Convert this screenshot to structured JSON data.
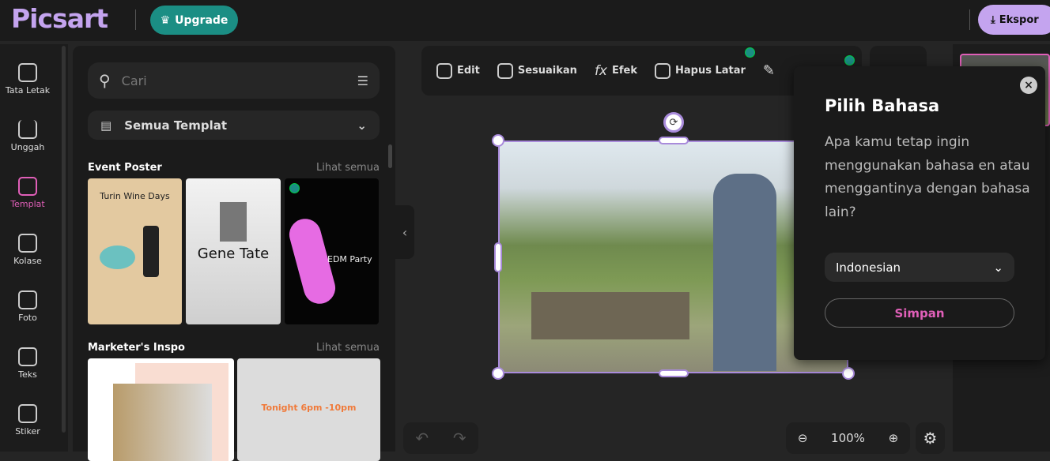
{
  "header": {
    "logo": "Picsart",
    "upgrade": "Upgrade",
    "export": "Ekspor"
  },
  "rail": [
    {
      "label": "Tata Letak"
    },
    {
      "label": "Unggah"
    },
    {
      "label": "Templat"
    },
    {
      "label": "Kolase"
    },
    {
      "label": "Foto"
    },
    {
      "label": "Teks"
    },
    {
      "label": "Stiker"
    }
  ],
  "panel": {
    "search_placeholder": "Cari",
    "template_select": "Semua Templat",
    "sections": [
      {
        "title": "Event Poster",
        "link": "Lihat semua",
        "thumbs": [
          "Turin Wine Days",
          "Gene Tate",
          "EDM Party"
        ]
      },
      {
        "title": "Marketer's Inspo",
        "link": "Lihat semua",
        "thumbs": [
          "",
          "Tonight 6pm -10pm"
        ]
      }
    ]
  },
  "toolbar": {
    "items": [
      "Edit",
      "Sesuaikan",
      "Efek",
      "Hapus Latar"
    ]
  },
  "popup": {
    "title": "Pilih Bahasa",
    "body": "Apa kamu tetap ingin menggunakan bahasa en atau menggantinya dengan bahasa lain?",
    "language": "Indonesian",
    "save": "Simpan"
  },
  "zoom": {
    "level": "100%"
  },
  "colors": {
    "accent": "#c4a4ef",
    "brand_pink": "#e05fb8",
    "upgrade": "#1b8e84"
  }
}
